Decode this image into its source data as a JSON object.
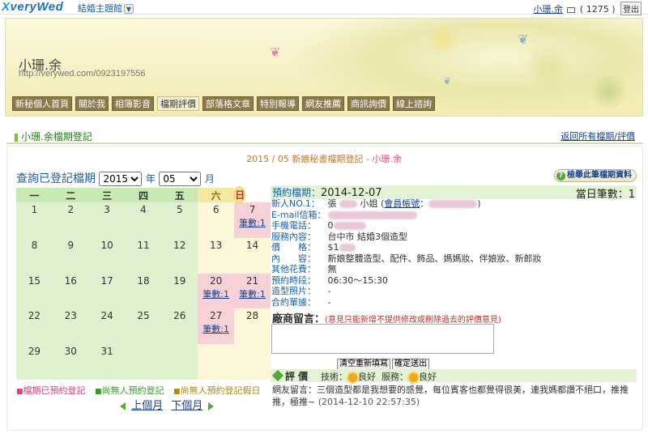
{
  "topbar": {
    "logo": "veryWed",
    "logo_x": "X",
    "theme_link": "結婚主題館",
    "user_name": "小珊.余",
    "mail_count": "( 1275 )",
    "logout": "登出"
  },
  "banner": {
    "title": "小珊.余",
    "url": "http://verywed.com/0923197556"
  },
  "nav": [
    {
      "label": "新秘個人首頁"
    },
    {
      "label": "關於我"
    },
    {
      "label": "相簿影音"
    },
    {
      "label": "檔期評價",
      "active": true
    },
    {
      "label": "部落格文章"
    },
    {
      "label": "特別報導"
    },
    {
      "label": "網友推薦"
    },
    {
      "label": "商訊詢價"
    },
    {
      "label": "線上諮詢"
    }
  ],
  "section": {
    "title": "小珊.余檔期登記",
    "back_link": "返回所有檔期/評價"
  },
  "subtitle": {
    "prefix": "2015 / 05 新娘秘書檔期登記 - ",
    "name": "小珊.余"
  },
  "query": {
    "label": "查詢已登記檔期",
    "year": "2015",
    "year_unit": "年",
    "month": "05",
    "month_unit": "月"
  },
  "calendar": {
    "weekdays": [
      "一",
      "二",
      "三",
      "四",
      "五",
      "六",
      "日"
    ],
    "count_label": "筆數:1",
    "weeks": [
      [
        {
          "d": "1"
        },
        {
          "d": "2"
        },
        {
          "d": "3"
        },
        {
          "d": "4"
        },
        {
          "d": "5"
        },
        {
          "d": "6"
        },
        {
          "d": "7",
          "booked": true
        }
      ],
      [
        {
          "d": "8"
        },
        {
          "d": "9"
        },
        {
          "d": "10"
        },
        {
          "d": "11"
        },
        {
          "d": "12"
        },
        {
          "d": "13"
        },
        {
          "d": "14"
        }
      ],
      [
        {
          "d": "15"
        },
        {
          "d": "16"
        },
        {
          "d": "17"
        },
        {
          "d": "18"
        },
        {
          "d": "19"
        },
        {
          "d": "20",
          "booked": true
        },
        {
          "d": "21",
          "booked": true
        }
      ],
      [
        {
          "d": "22"
        },
        {
          "d": "23"
        },
        {
          "d": "24"
        },
        {
          "d": "25"
        },
        {
          "d": "26"
        },
        {
          "d": "27",
          "booked": true
        },
        {
          "d": "28"
        }
      ],
      [
        {
          "d": "29"
        },
        {
          "d": "30"
        },
        {
          "d": "31"
        },
        {
          "d": ""
        },
        {
          "d": ""
        },
        {
          "d": ""
        },
        {
          "d": ""
        }
      ]
    ]
  },
  "legend": {
    "booked": "檔期已預約登記",
    "free_weekday": "尚無人預約登記",
    "free_holiday": "尚無人預約登記假日"
  },
  "pager": {
    "prev": "上個月",
    "next": "下個月"
  },
  "detail": {
    "button": "檢舉此筆檔期資料",
    "date_label": "預約檔期：",
    "date_value": "2014-12-07",
    "count_label": "當日筆數：",
    "count_value": "1",
    "rows": {
      "bride_k": "新人NO.1：",
      "bride_v1": "張",
      "bride_v2": "小姐",
      "account_label": "會員帳號",
      "email_k": "E-mail信箱：",
      "phone_k": "手機電話：",
      "phone_v": "0",
      "service_k": "服務內容：",
      "service_v": "台中市 結婚3個造型",
      "price_k": "價　　格：",
      "price_v": "$1",
      "content_k": "內　　容：",
      "content_v": "新娘整體造型、配件、飾品、媽媽妝、伴娘妝、新郎妝",
      "other_k": "其他花費：",
      "other_v": "無",
      "time_k": "預約時段：",
      "time_v": "06:30～15:30",
      "photo_k": "造型照片：",
      "photo_v": "-",
      "contract_k": "合約單據：",
      "contract_v": "-"
    },
    "shop_label": "廠商留言：",
    "shop_note": "(意見只能新增不提供修改或刪除過去的評價意見)",
    "btn_reset": "清空重新填寫",
    "btn_send": "確定送出"
  },
  "evaluation": {
    "title": "評 價",
    "tech_label": "技術：",
    "tech_value": "良好",
    "service_label": "服務：",
    "service_value": "良好",
    "review_text": "網友留言：三個造型都是我想要的感覺，每位賓客也都覺得很美，連我媽都讚不絕口，推推推，極推~",
    "review_time": "(2014-12-10 22:57:35)"
  },
  "colors": {
    "booked": "#f6d2d6",
    "weekday": "#dff2d0",
    "weekend": "#fbf7d8",
    "accent_green": "#5aa53a",
    "link_blue": "#1a3f8c"
  }
}
